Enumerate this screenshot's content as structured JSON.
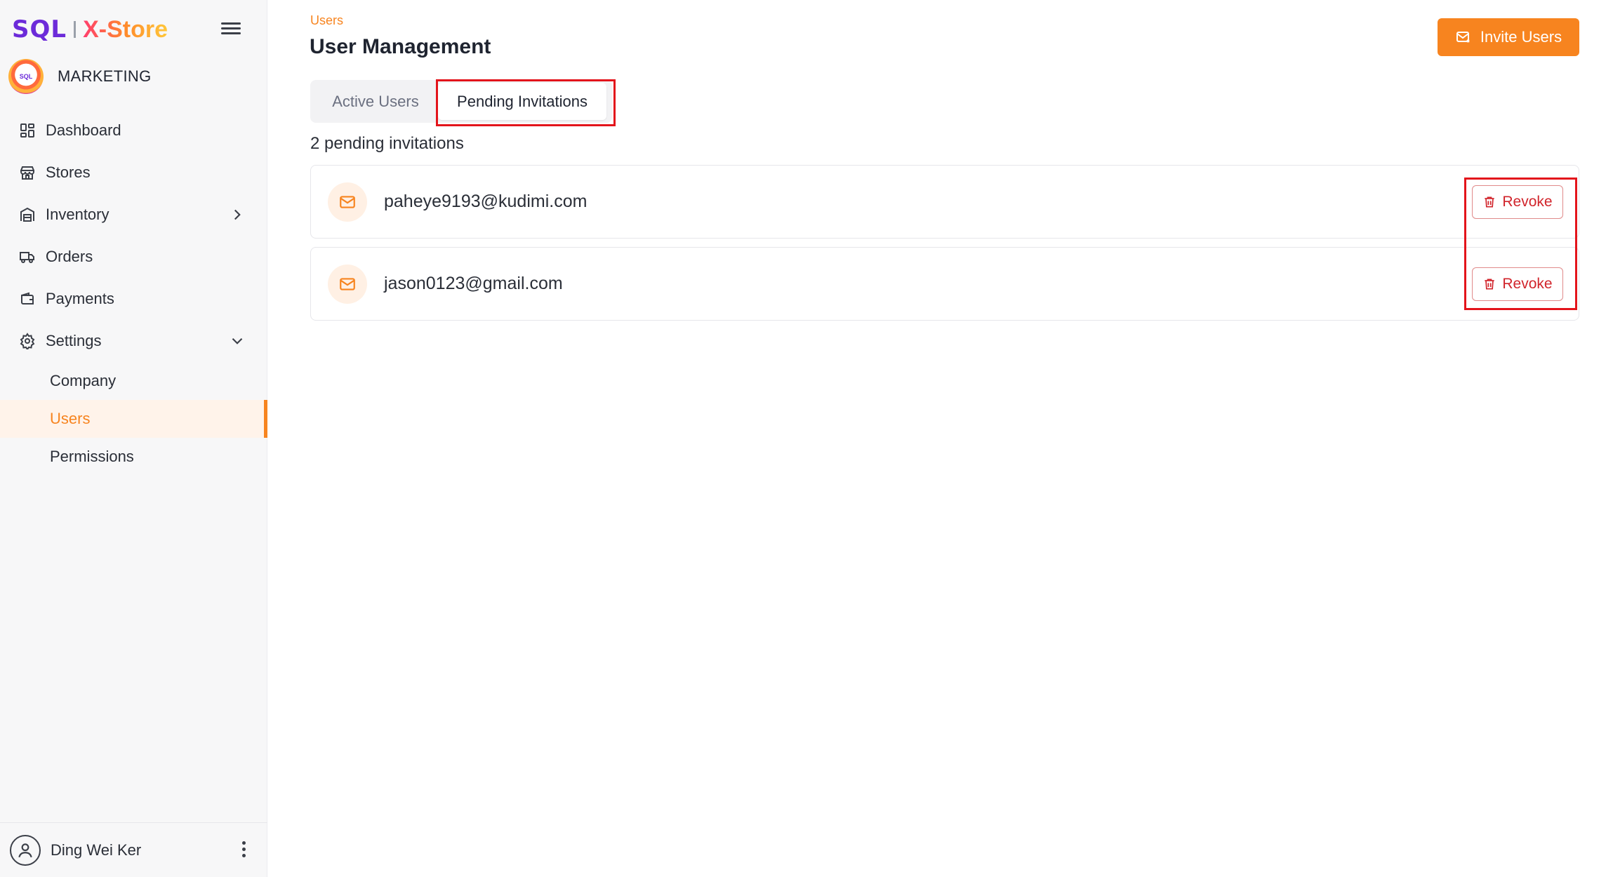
{
  "brand": {
    "sql": "SQL",
    "name": "X-Store"
  },
  "company": {
    "name": "MARKETING",
    "logo_text": "SQL"
  },
  "nav": {
    "items": [
      {
        "label": "Dashboard",
        "icon": "dashboard-icon"
      },
      {
        "label": "Stores",
        "icon": "store-icon"
      },
      {
        "label": "Inventory",
        "icon": "warehouse-icon",
        "chevron": "chevron-right-icon"
      },
      {
        "label": "Orders",
        "icon": "truck-icon"
      },
      {
        "label": "Payments",
        "icon": "wallet-icon"
      },
      {
        "label": "Settings",
        "icon": "gear-icon",
        "chevron": "chevron-down-icon"
      }
    ],
    "settings_children": [
      {
        "label": "Company",
        "active": false
      },
      {
        "label": "Users",
        "active": true
      },
      {
        "label": "Permissions",
        "active": false
      }
    ]
  },
  "user": {
    "name": "Ding Wei Ker",
    "icon": "user-icon"
  },
  "header": {
    "breadcrumb": "Users",
    "title": "User Management",
    "invite_label": "Invite Users"
  },
  "tabs": [
    {
      "label": "Active Users",
      "active": false
    },
    {
      "label": "Pending Invitations",
      "active": true
    }
  ],
  "invitations": {
    "count_text": "2 pending invitations",
    "items": [
      {
        "email": "paheye9193@kudimi.com",
        "action": "Revoke"
      },
      {
        "email": "jason0123@gmail.com",
        "action": "Revoke"
      }
    ]
  },
  "colors": {
    "accent": "#f7841f",
    "danger": "#d1242b",
    "highlight": "#e3141b",
    "brand_purple": "#6c2bd9"
  }
}
